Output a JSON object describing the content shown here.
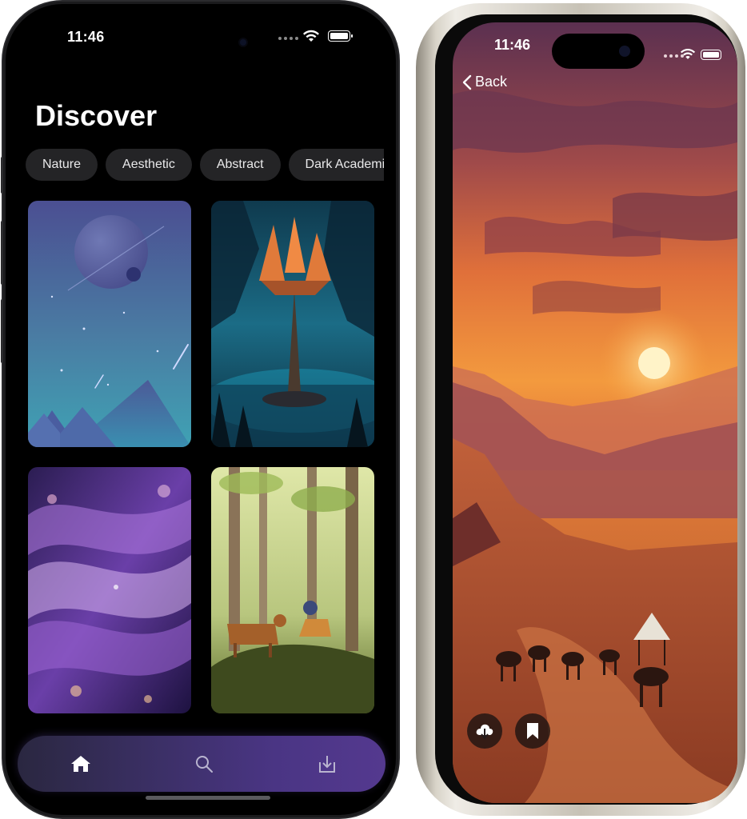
{
  "left_screen": {
    "status_time": "11:46",
    "page_title": "Discover",
    "categories": [
      "Nature",
      "Aesthetic",
      "Abstract",
      "Dark Academia"
    ],
    "tab_bar": {
      "tabs": [
        {
          "icon": "home-icon",
          "selected": true
        },
        {
          "icon": "search-icon",
          "selected": false
        },
        {
          "icon": "download-icon",
          "selected": false
        }
      ]
    }
  },
  "right_screen": {
    "status_time": "11:46",
    "back_label": "Back",
    "actions": [
      {
        "icon": "cloud-download-icon"
      },
      {
        "icon": "bookmark-icon"
      }
    ]
  },
  "colors": {
    "background": "#000000",
    "chip_background": "#242426",
    "tab_bar_accent": "#4a3584"
  }
}
